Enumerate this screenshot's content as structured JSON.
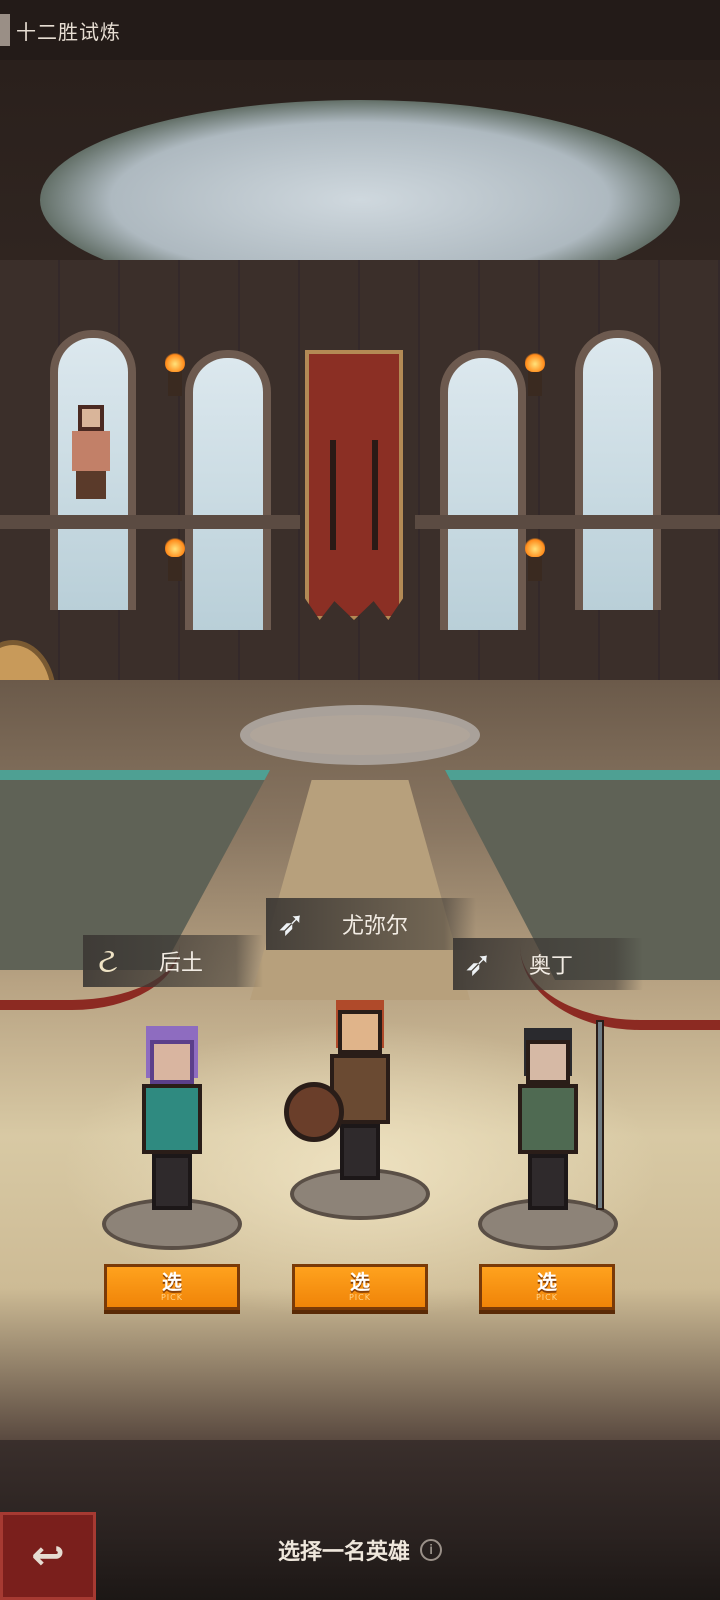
{
  "header": {
    "title": "十二胜试炼"
  },
  "heroes": [
    {
      "name": "后土",
      "emblem_icon": "mountain-rune-icon",
      "pick_label": "选",
      "pick_sub": "PICK"
    },
    {
      "name": "尤弥尔",
      "emblem_icon": "wolf-head-icon",
      "pick_label": "选",
      "pick_sub": "PICK"
    },
    {
      "name": "奥丁",
      "emblem_icon": "wolf-head-icon",
      "pick_label": "选",
      "pick_sub": "PICK"
    }
  ],
  "footer": {
    "prompt": "选择一名英雄",
    "back_icon": "back-arrow-icon",
    "info_icon": "info-icon"
  },
  "colors": {
    "pick_button": "#f7901a",
    "back_button": "#7a1f1c",
    "banner": "#8b2f24",
    "pool_edge": "#4ea093"
  }
}
